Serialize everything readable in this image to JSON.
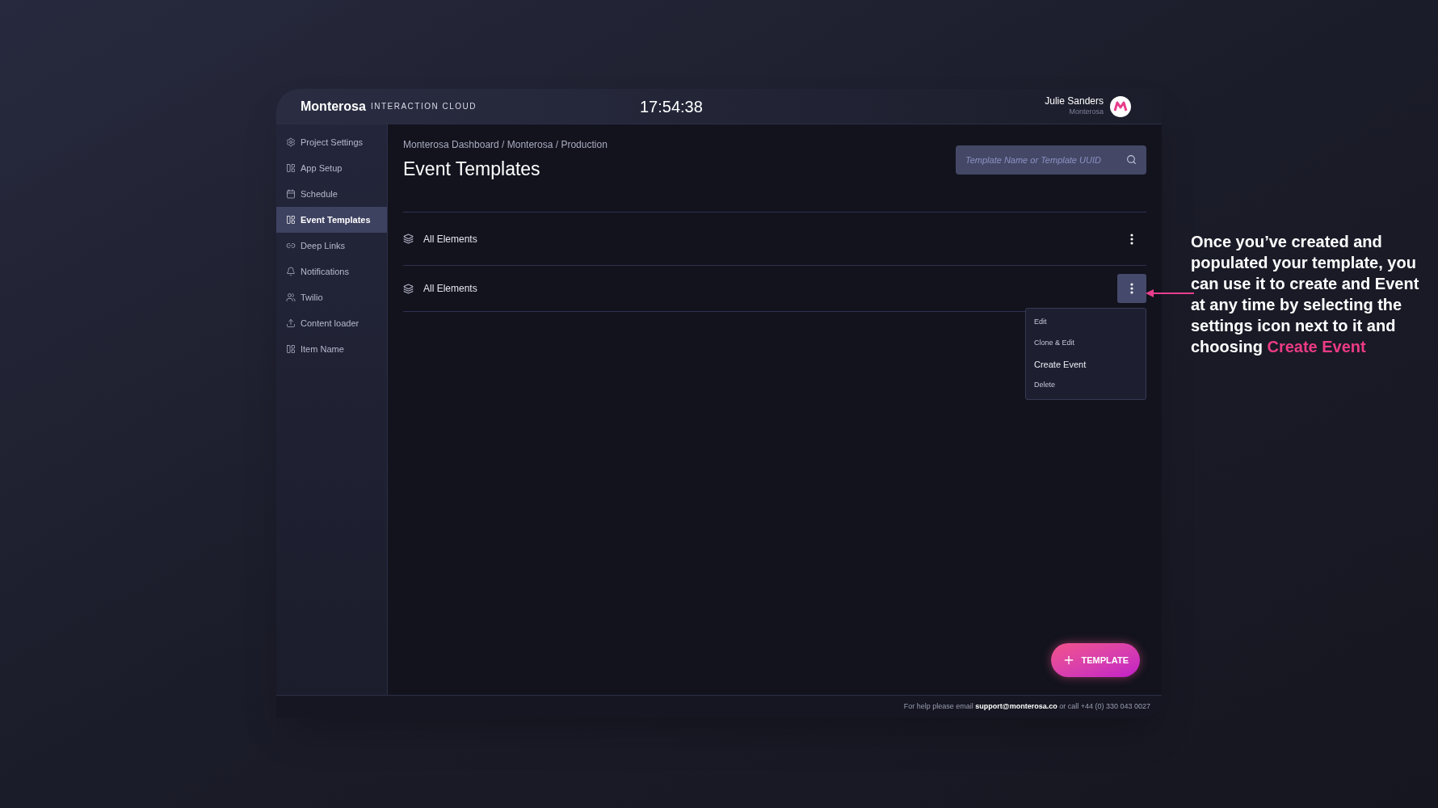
{
  "header": {
    "brand": "Monterosa",
    "product": "INTERACTION CLOUD",
    "clock": "17:54:38",
    "user": {
      "name": "Julie Sanders",
      "org": "Monterosa"
    }
  },
  "sidebar": {
    "items": [
      {
        "label": "Project Settings",
        "kind": "gear",
        "selected": false
      },
      {
        "label": "App Setup",
        "kind": "panel",
        "selected": false
      },
      {
        "label": "Schedule",
        "kind": "calendar",
        "selected": false
      },
      {
        "label": "Event Templates",
        "kind": "panel",
        "selected": true
      },
      {
        "label": "Deep Links",
        "kind": "link",
        "selected": false
      },
      {
        "label": "Notifications",
        "kind": "bell",
        "selected": false
      },
      {
        "label": "Twilio",
        "kind": "people",
        "selected": false
      },
      {
        "label": "Content loader",
        "kind": "upload",
        "selected": false
      },
      {
        "label": "Item Name",
        "kind": "panel",
        "selected": false
      }
    ]
  },
  "main": {
    "breadcrumb": "Monterosa Dashboard / Monterosa / Production",
    "title": "Event Templates",
    "search": {
      "placeholder": "Template Name or Template UUID"
    },
    "rows": [
      {
        "label": "All Elements",
        "menu_open": false
      },
      {
        "label": "All Elements",
        "menu_open": true
      }
    ],
    "menu": [
      {
        "label": "Edit",
        "selected": false
      },
      {
        "label": "Clone & Edit",
        "selected": false
      },
      {
        "label": "Create Event",
        "selected": true
      },
      {
        "label": "Delete",
        "selected": false
      }
    ],
    "fab": "TEMPLATE"
  },
  "footer": "For help please email **support@monterosa.co** or call +44 (0) 330 043 0027",
  "annotation": {
    "text": "Once you’ve created and populated your template, you can use it to create and Event at any time by selecting the settings icon next to it and choosing",
    "highlight": "Create Event"
  }
}
